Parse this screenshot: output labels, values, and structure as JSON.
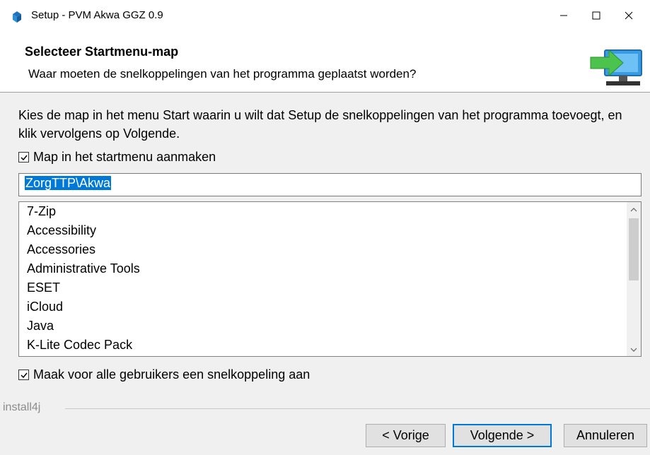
{
  "window": {
    "title": "Setup - PVM Akwa GGZ 0.9",
    "icons": [
      "installer-icon",
      "minimize-icon",
      "maximize-icon",
      "close-icon"
    ]
  },
  "header": {
    "title": "Selecteer Startmenu-map",
    "subtitle": "Waar moeten de snelkoppelingen van het programma geplaatst worden?",
    "icon": "computer-arrow-icon"
  },
  "content": {
    "instructions": "Kies de map in het menu Start waarin u wilt dat Setup de snelkoppelingen van het programma toevoegt, en klik vervolgens op Volgende.",
    "create_folder_checkbox": {
      "label": "Map in het startmenu aanmaken",
      "checked": true
    },
    "folder_value": "ZorgTTP\\Akwa",
    "folders": [
      "7-Zip",
      "Accessibility",
      "Accessories",
      "Administrative Tools",
      "ESET",
      "iCloud",
      "Java",
      "K-Lite Codec Pack"
    ],
    "all_users_checkbox": {
      "label": "Maak voor alle gebruikers een snelkoppeling aan",
      "checked": true
    }
  },
  "footer": {
    "brand": "install4j",
    "back_label": "< Vorige",
    "next_label": "Volgende >",
    "cancel_label": "Annuleren"
  },
  "colors": {
    "selection": "#0078d7",
    "monitor": "#3a9be0",
    "arrow": "#4cc34c"
  }
}
